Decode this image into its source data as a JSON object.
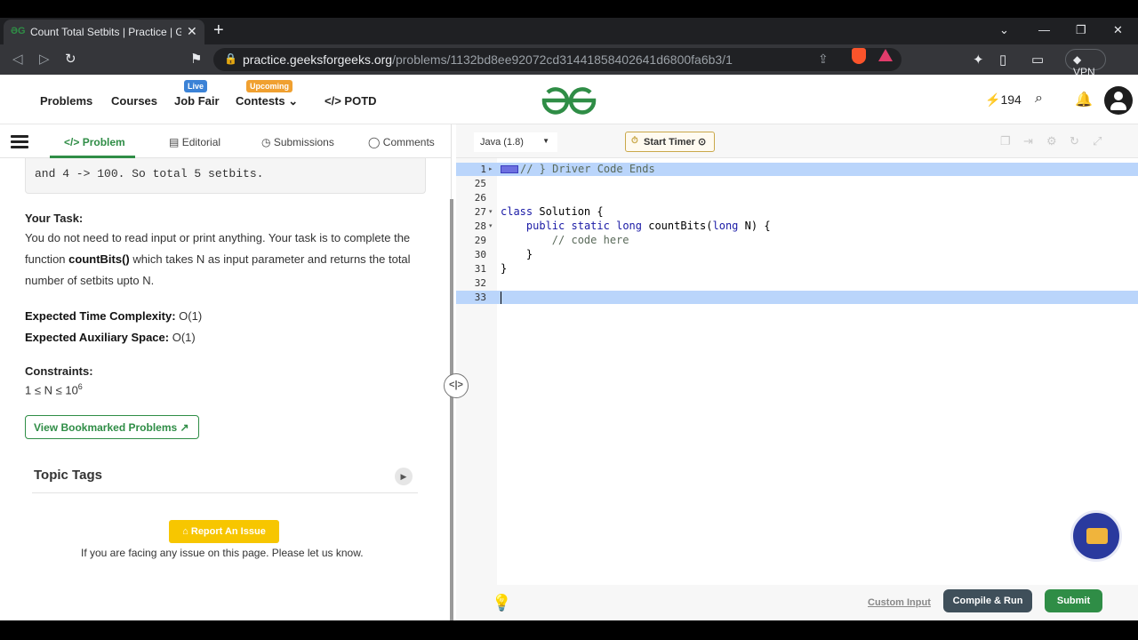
{
  "browser": {
    "tab_title": "Count Total Setbits | Practice | Ge",
    "tab_favicon": "gfg-favicon",
    "url_host": "practice.geeksforgeeks.org",
    "url_path": "/problems/1132bd8ee92072cd31441858402641d6800fa6b3/1",
    "vpn_label": "VPN",
    "brave_badge": "11"
  },
  "header": {
    "nav": {
      "problems": "Problems",
      "courses": "Courses",
      "job_fair": "Job Fair",
      "contests": "Contests",
      "potd": "POTD",
      "potd_symbol": "</>"
    },
    "badges": {
      "live": "Live",
      "upcoming": "Upcoming"
    },
    "streak": "194",
    "colors": {
      "brand": "#2f8d46",
      "live_badge": "#3b82d6",
      "upcoming_badge": "#f0a030"
    }
  },
  "left_tabs": {
    "problem": "Problem",
    "editorial": "Editorial",
    "submissions": "Submissions",
    "comments": "Comments"
  },
  "problem": {
    "example_tail": "and 4 -> 100. So total 5 setbits.",
    "your_task_title": "Your Task:",
    "your_task_before": "You do not need to read input or print anything. Your task is to complete the function ",
    "your_task_fn": "countBits()",
    "your_task_after": " which takes N as input parameter and returns the total number of setbits upto N.",
    "time_label": "Expected Time Complexity:",
    "time_value": "O(1)",
    "space_label": "Expected Auxiliary Space:",
    "space_value": "O(1)",
    "constraints_title": "Constraints:",
    "constraints_base": "1 ≤ N ≤ 10",
    "constraints_exp": "6",
    "bookmark_button": "View Bookmarked Problems",
    "topic_tags": "Topic Tags",
    "report_button": "Report An Issue",
    "report_note": "If you are facing any issue on this page. Please let us know."
  },
  "editor": {
    "language": "Java (1.8)",
    "timer_button": "Start Timer",
    "lines": [
      {
        "num": "1",
        "fold": "▸",
        "text": "// } Driver Code Ends",
        "highlight": true,
        "marker": true
      },
      {
        "num": "25",
        "fold": "",
        "text": "",
        "highlight": false
      },
      {
        "num": "26",
        "fold": "",
        "text": "",
        "highlight": false
      },
      {
        "num": "27",
        "fold": "▾",
        "text": "class Solution {",
        "highlight": false
      },
      {
        "num": "28",
        "fold": "▾",
        "text": "    public static long countBits(long N) {",
        "highlight": false
      },
      {
        "num": "29",
        "fold": "",
        "text": "        // code here",
        "highlight": false
      },
      {
        "num": "30",
        "fold": "",
        "text": "    }",
        "highlight": false
      },
      {
        "num": "31",
        "fold": "",
        "text": "}",
        "highlight": false
      },
      {
        "num": "32",
        "fold": "",
        "text": "",
        "highlight": false
      },
      {
        "num": "33",
        "fold": "",
        "text": "",
        "highlight": true
      }
    ],
    "custom_input": "Custom Input",
    "compile_button": "Compile & Run",
    "submit_button": "Submit"
  }
}
